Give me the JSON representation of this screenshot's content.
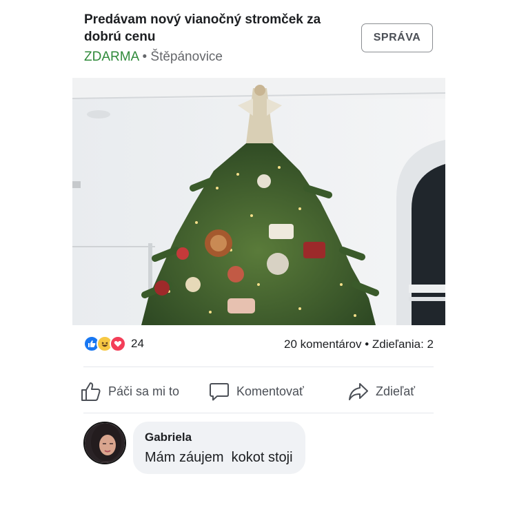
{
  "listing": {
    "title": "Predávam nový vianočný stromček za dobrú cenu",
    "price": "ZDARMA",
    "separator": "•",
    "location": "Štěpánovice",
    "message_button": "SPRÁVA"
  },
  "stats": {
    "reaction_icons": [
      "like-icon",
      "haha-icon",
      "love-icon"
    ],
    "reaction_count": "24",
    "comments": "20 komentárov",
    "separator": "•",
    "shares": "Zdieľania: 2"
  },
  "actions": {
    "like": "Páči sa mi to",
    "comment": "Komentovať",
    "share": "Zdieľať"
  },
  "comment": {
    "author": "Gabriela",
    "text": "Mám záujem  kokot stoji"
  },
  "colors": {
    "price_green": "#2f8a3a",
    "like_blue": "#1877f2",
    "love_red": "#f33e58",
    "haha_yellow": "#f7c843",
    "bubble_gray": "#f0f2f5"
  }
}
